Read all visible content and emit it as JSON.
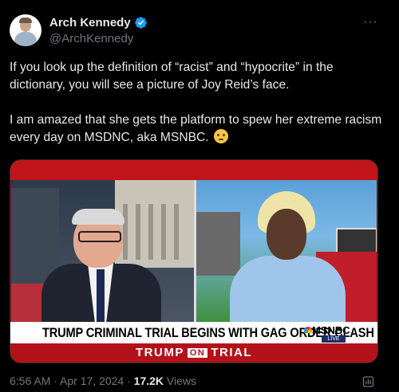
{
  "author": {
    "name": "Arch Kennedy",
    "handle": "@ArchKennedy",
    "verified_icon": "verified-badge-icon",
    "accent": "#1d9bf0"
  },
  "more_icon": "more-dots-icon",
  "more_label": "···",
  "text": {
    "paragraph1": "If you look up the definition of “racist” and “hypocrite” in the dictionary, you will see a picture of Joy Reid’s face.",
    "paragraph2": "I am amazed that she gets the platform to spew her extreme racism every day on MSDNC, aka MSNBC.",
    "emoji": "face-with-rolling-eyes-emoji"
  },
  "media": {
    "chyron": "TRUMP CRIMINAL TRIAL BEGINS WITH GAG ORDER CLASH",
    "logo": "MSNBC",
    "live": "LIVE",
    "bottom_left": "TRUMP",
    "bottom_on": "ON",
    "bottom_right": "TRIAL"
  },
  "meta": {
    "time": "6:56 AM",
    "sep": " · ",
    "date": "Apr 17, 2024",
    "views_count": "17.2K",
    "views_label": " Views"
  },
  "analytics_icon": "analytics-icon"
}
